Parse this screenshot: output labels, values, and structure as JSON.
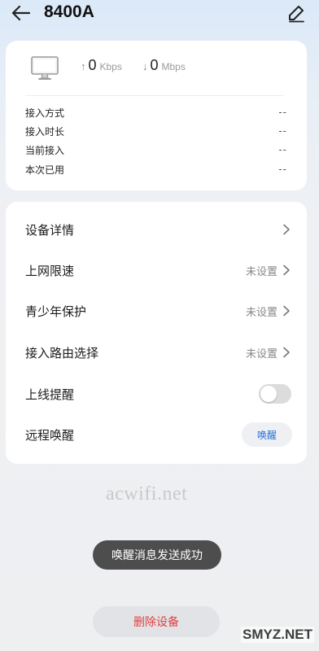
{
  "header": {
    "title": "8400A",
    "back_icon": "arrow-left-icon",
    "edit_icon": "pencil-icon"
  },
  "device": {
    "icon": "monitor-icon",
    "upload": {
      "arrow": "↑",
      "value": "0",
      "unit": "Kbps"
    },
    "download": {
      "arrow": "↓",
      "value": "0",
      "unit": "Mbps"
    },
    "info": [
      {
        "label": "接入方式",
        "value": "--"
      },
      {
        "label": "接入时长",
        "value": "--"
      },
      {
        "label": "当前接入",
        "value": "--"
      },
      {
        "label": "本次已用",
        "value": "--"
      }
    ]
  },
  "settings": {
    "device_details": {
      "label": "设备详情"
    },
    "speed_limit": {
      "label": "上网限速",
      "value": "未设置"
    },
    "youth_protection": {
      "label": "青少年保护",
      "value": "未设置"
    },
    "route_select": {
      "label": "接入路由选择",
      "value": "未设置"
    },
    "online_alert": {
      "label": "上线提醒",
      "enabled": false
    },
    "remote_wake": {
      "label": "远程唤醒",
      "button": "唤醒"
    }
  },
  "watermark": "acwifi.net",
  "toast": "唤醒消息发送成功",
  "delete_button": "删除设备",
  "corner_watermark": "SMYZ.NET",
  "colors": {
    "accent": "#2a6fd6",
    "danger": "#e04040",
    "toast_bg": "#4d4d4d"
  }
}
